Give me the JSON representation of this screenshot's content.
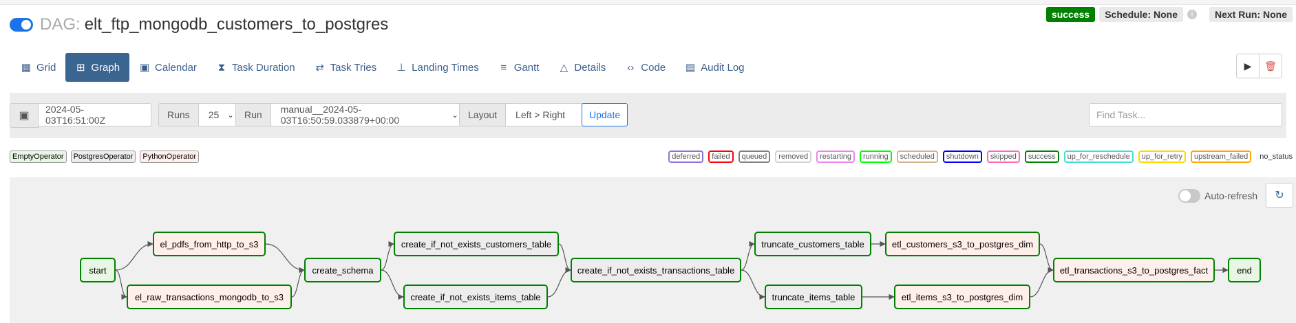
{
  "header": {
    "dag_label": "DAG:",
    "dag_id": "elt_ftp_mongodb_customers_to_postgres",
    "status": "success",
    "schedule": "Schedule: None",
    "info_icon": "info-icon",
    "next_run": "Next Run: None"
  },
  "tabs": [
    {
      "label": "Grid",
      "icon": "grid-icon"
    },
    {
      "label": "Graph",
      "icon": "graph-icon"
    },
    {
      "label": "Calendar",
      "icon": "calendar-icon"
    },
    {
      "label": "Task Duration",
      "icon": "hourglass-icon"
    },
    {
      "label": "Task Tries",
      "icon": "repeat-icon"
    },
    {
      "label": "Landing Times",
      "icon": "landing-icon"
    },
    {
      "label": "Gantt",
      "icon": "gantt-icon"
    },
    {
      "label": "Details",
      "icon": "warning-icon"
    },
    {
      "label": "Code",
      "icon": "code-icon"
    },
    {
      "label": "Audit Log",
      "icon": "search-document-icon"
    }
  ],
  "actions": {
    "trigger_icon": "play-icon",
    "delete_icon": "trash-icon"
  },
  "filter": {
    "base_date": "2024-05-03T16:51:00Z",
    "runs_label": "Runs",
    "runs_value": "25",
    "run_label": "Run",
    "run_value": "manual__2024-05-03T16:50:59.033879+00:00",
    "layout_label": "Layout",
    "layout_value": "Left > Right",
    "update_label": "Update",
    "find_placeholder": "Find Task..."
  },
  "operator_legend": [
    "EmptyOperator",
    "PostgresOperator",
    "PythonOperator"
  ],
  "operator_colors": {
    "EmptyOperator": "#e8f7e4",
    "PostgresOperator": "#ededed",
    "PythonOperator": "#ffefeb"
  },
  "state_legend": [
    {
      "label": "deferred",
      "color": "#9370db"
    },
    {
      "label": "failed",
      "color": "#ff0000"
    },
    {
      "label": "queued",
      "color": "#808080"
    },
    {
      "label": "removed",
      "color": "#d3d3d3"
    },
    {
      "label": "restarting",
      "color": "#ee82ee"
    },
    {
      "label": "running",
      "color": "#00ff00"
    },
    {
      "label": "scheduled",
      "color": "#d2b48c"
    },
    {
      "label": "shutdown",
      "color": "#0000ff"
    },
    {
      "label": "skipped",
      "color": "#ff69b4"
    },
    {
      "label": "success",
      "color": "#008000"
    },
    {
      "label": "up_for_reschedule",
      "color": "#40e0d0"
    },
    {
      "label": "up_for_retry",
      "color": "#ffd700"
    },
    {
      "label": "upstream_failed",
      "color": "#ffa500"
    },
    {
      "label": "no_status",
      "color": ""
    }
  ],
  "graph": {
    "auto_refresh_label": "Auto-refresh",
    "refresh_icon": "refresh-icon",
    "tasks": [
      {
        "id": "start",
        "operator": "EmptyOperator",
        "state": "success"
      },
      {
        "id": "el_pdfs_from_http_to_s3",
        "operator": "PythonOperator",
        "state": "success"
      },
      {
        "id": "el_raw_transactions_mongodb_to_s3",
        "operator": "PythonOperator",
        "state": "success"
      },
      {
        "id": "create_schema",
        "operator": "PostgresOperator",
        "state": "success"
      },
      {
        "id": "create_if_not_exists_customers_table",
        "operator": "PostgresOperator",
        "state": "success"
      },
      {
        "id": "create_if_not_exists_items_table",
        "operator": "PostgresOperator",
        "state": "success"
      },
      {
        "id": "create_if_not_exists_transactions_table",
        "operator": "PostgresOperator",
        "state": "success"
      },
      {
        "id": "truncate_customers_table",
        "operator": "PostgresOperator",
        "state": "success"
      },
      {
        "id": "truncate_items_table",
        "operator": "PostgresOperator",
        "state": "success"
      },
      {
        "id": "etl_customers_s3_to_postgres_dim",
        "operator": "PythonOperator",
        "state": "success"
      },
      {
        "id": "etl_items_s3_to_postgres_dim",
        "operator": "PythonOperator",
        "state": "success"
      },
      {
        "id": "etl_transactions_s3_to_postgres_fact",
        "operator": "PythonOperator",
        "state": "success"
      },
      {
        "id": "end",
        "operator": "EmptyOperator",
        "state": "success"
      }
    ],
    "edges": [
      [
        "start",
        "el_pdfs_from_http_to_s3"
      ],
      [
        "start",
        "el_raw_transactions_mongodb_to_s3"
      ],
      [
        "el_pdfs_from_http_to_s3",
        "create_schema"
      ],
      [
        "el_raw_transactions_mongodb_to_s3",
        "create_schema"
      ],
      [
        "create_schema",
        "create_if_not_exists_customers_table"
      ],
      [
        "create_schema",
        "create_if_not_exists_items_table"
      ],
      [
        "create_if_not_exists_customers_table",
        "create_if_not_exists_transactions_table"
      ],
      [
        "create_if_not_exists_items_table",
        "create_if_not_exists_transactions_table"
      ],
      [
        "create_if_not_exists_transactions_table",
        "truncate_customers_table"
      ],
      [
        "create_if_not_exists_transactions_table",
        "truncate_items_table"
      ],
      [
        "truncate_customers_table",
        "etl_customers_s3_to_postgres_dim"
      ],
      [
        "truncate_items_table",
        "etl_items_s3_to_postgres_dim"
      ],
      [
        "etl_customers_s3_to_postgres_dim",
        "etl_transactions_s3_to_postgres_fact"
      ],
      [
        "etl_items_s3_to_postgres_dim",
        "etl_transactions_s3_to_postgres_fact"
      ],
      [
        "etl_transactions_s3_to_postgres_fact",
        "end"
      ]
    ]
  }
}
